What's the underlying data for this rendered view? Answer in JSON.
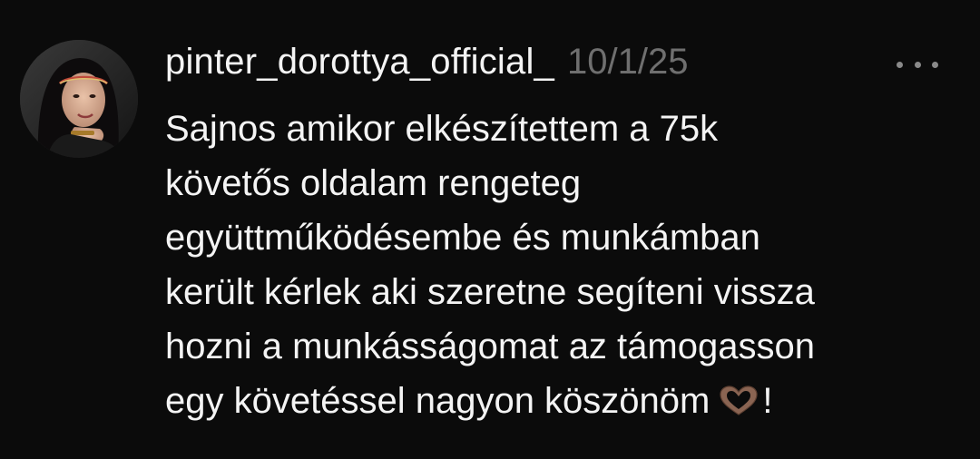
{
  "post": {
    "username": "pinter_dorottya_official_",
    "timestamp": "10/1/25",
    "avatar_icon": "profile-photo",
    "more_icon": "more-horizontal-icon",
    "body_lines": [
      "Sajnos amikor elkészítettem a 75k",
      "követős oldalam rengeteg",
      "együttműködésembe és munkámban",
      "került kérlek aki szeretne segíteni vissza",
      "hozni a munkásságomat az támogasson",
      "egy követéssel nagyon köszönöm"
    ],
    "body_end": "!",
    "emoji": "heart-hands-emoji",
    "colors": {
      "background": "#0b0b0b",
      "text": "#f4f4f4",
      "muted": "#6f6f6f"
    }
  }
}
